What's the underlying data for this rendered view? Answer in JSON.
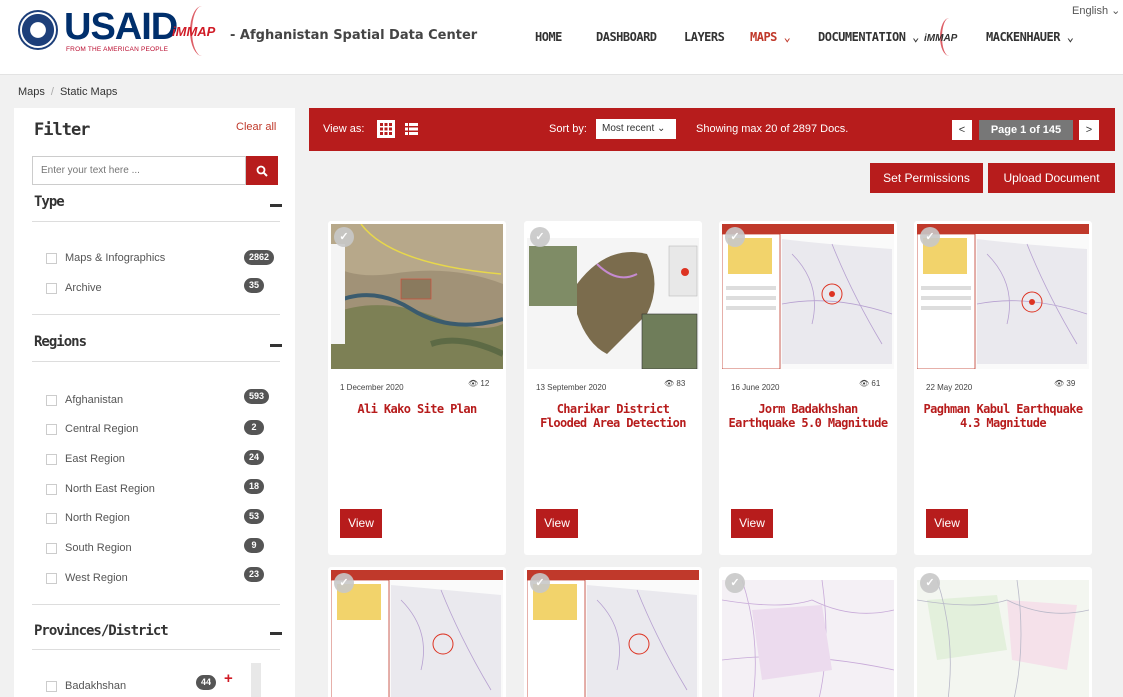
{
  "header": {
    "usaid": "USAID",
    "usaid_tag": "FROM THE AMERICAN PEOPLE",
    "immap": "iMMAP",
    "site_title": "Afghanistan Spatial Data Center",
    "language": "English",
    "nav": [
      "HOME",
      "DASHBOARD",
      "LAYERS",
      "MAPS",
      "DOCUMENTATION",
      "MACKENHAUER"
    ],
    "immap_right": "iMMAP"
  },
  "breadcrumb": [
    "Maps",
    "Static Maps"
  ],
  "sidebar": {
    "title": "Filter",
    "clear_all": "Clear all",
    "search_placeholder": "Enter your text here ...",
    "sections": {
      "type": {
        "title": "Type",
        "options": [
          {
            "label": "Maps & Infographics",
            "count": "2862"
          },
          {
            "label": "Archive",
            "count": "35"
          }
        ]
      },
      "regions": {
        "title": "Regions",
        "options": [
          {
            "label": "Afghanistan",
            "count": "593"
          },
          {
            "label": "Central Region",
            "count": "2"
          },
          {
            "label": "East Region",
            "count": "24"
          },
          {
            "label": "North East Region",
            "count": "18"
          },
          {
            "label": "North Region",
            "count": "53"
          },
          {
            "label": "South Region",
            "count": "9"
          },
          {
            "label": "West Region",
            "count": "23"
          }
        ]
      },
      "provinces": {
        "title": "Provinces/District",
        "options": [
          {
            "label": "Badakhshan",
            "count": "44"
          }
        ]
      }
    }
  },
  "toolbar": {
    "view_as": "View as:",
    "sort_by": "Sort by:",
    "sort_value": "Most recent",
    "showing": "Showing max 20 of 2897 Docs.",
    "page": "Page 1 of 145",
    "prev": "<",
    "next": ">"
  },
  "actions": {
    "set_permissions": "Set Permissions",
    "upload_document": "Upload Document"
  },
  "cards": [
    {
      "date": "1 December 2020",
      "views": "12",
      "title": "Ali Kako Site Plan",
      "view": "View"
    },
    {
      "date": "13 September 2020",
      "views": "83",
      "title": "Charikar District Flooded Area Detection",
      "view": "View"
    },
    {
      "date": "16 June 2020",
      "views": "61",
      "title": "Jorm Badakhshan Earthquake 5.0 Magnitude",
      "view": "View"
    },
    {
      "date": "22 May 2020",
      "views": "39",
      "title": "Paghman Kabul Earthquake 4.3 Magnitude",
      "view": "View"
    }
  ],
  "colors": {
    "brand_red": "#b71c1c",
    "badge": "#555555",
    "usaid_blue": "#002f6c"
  }
}
